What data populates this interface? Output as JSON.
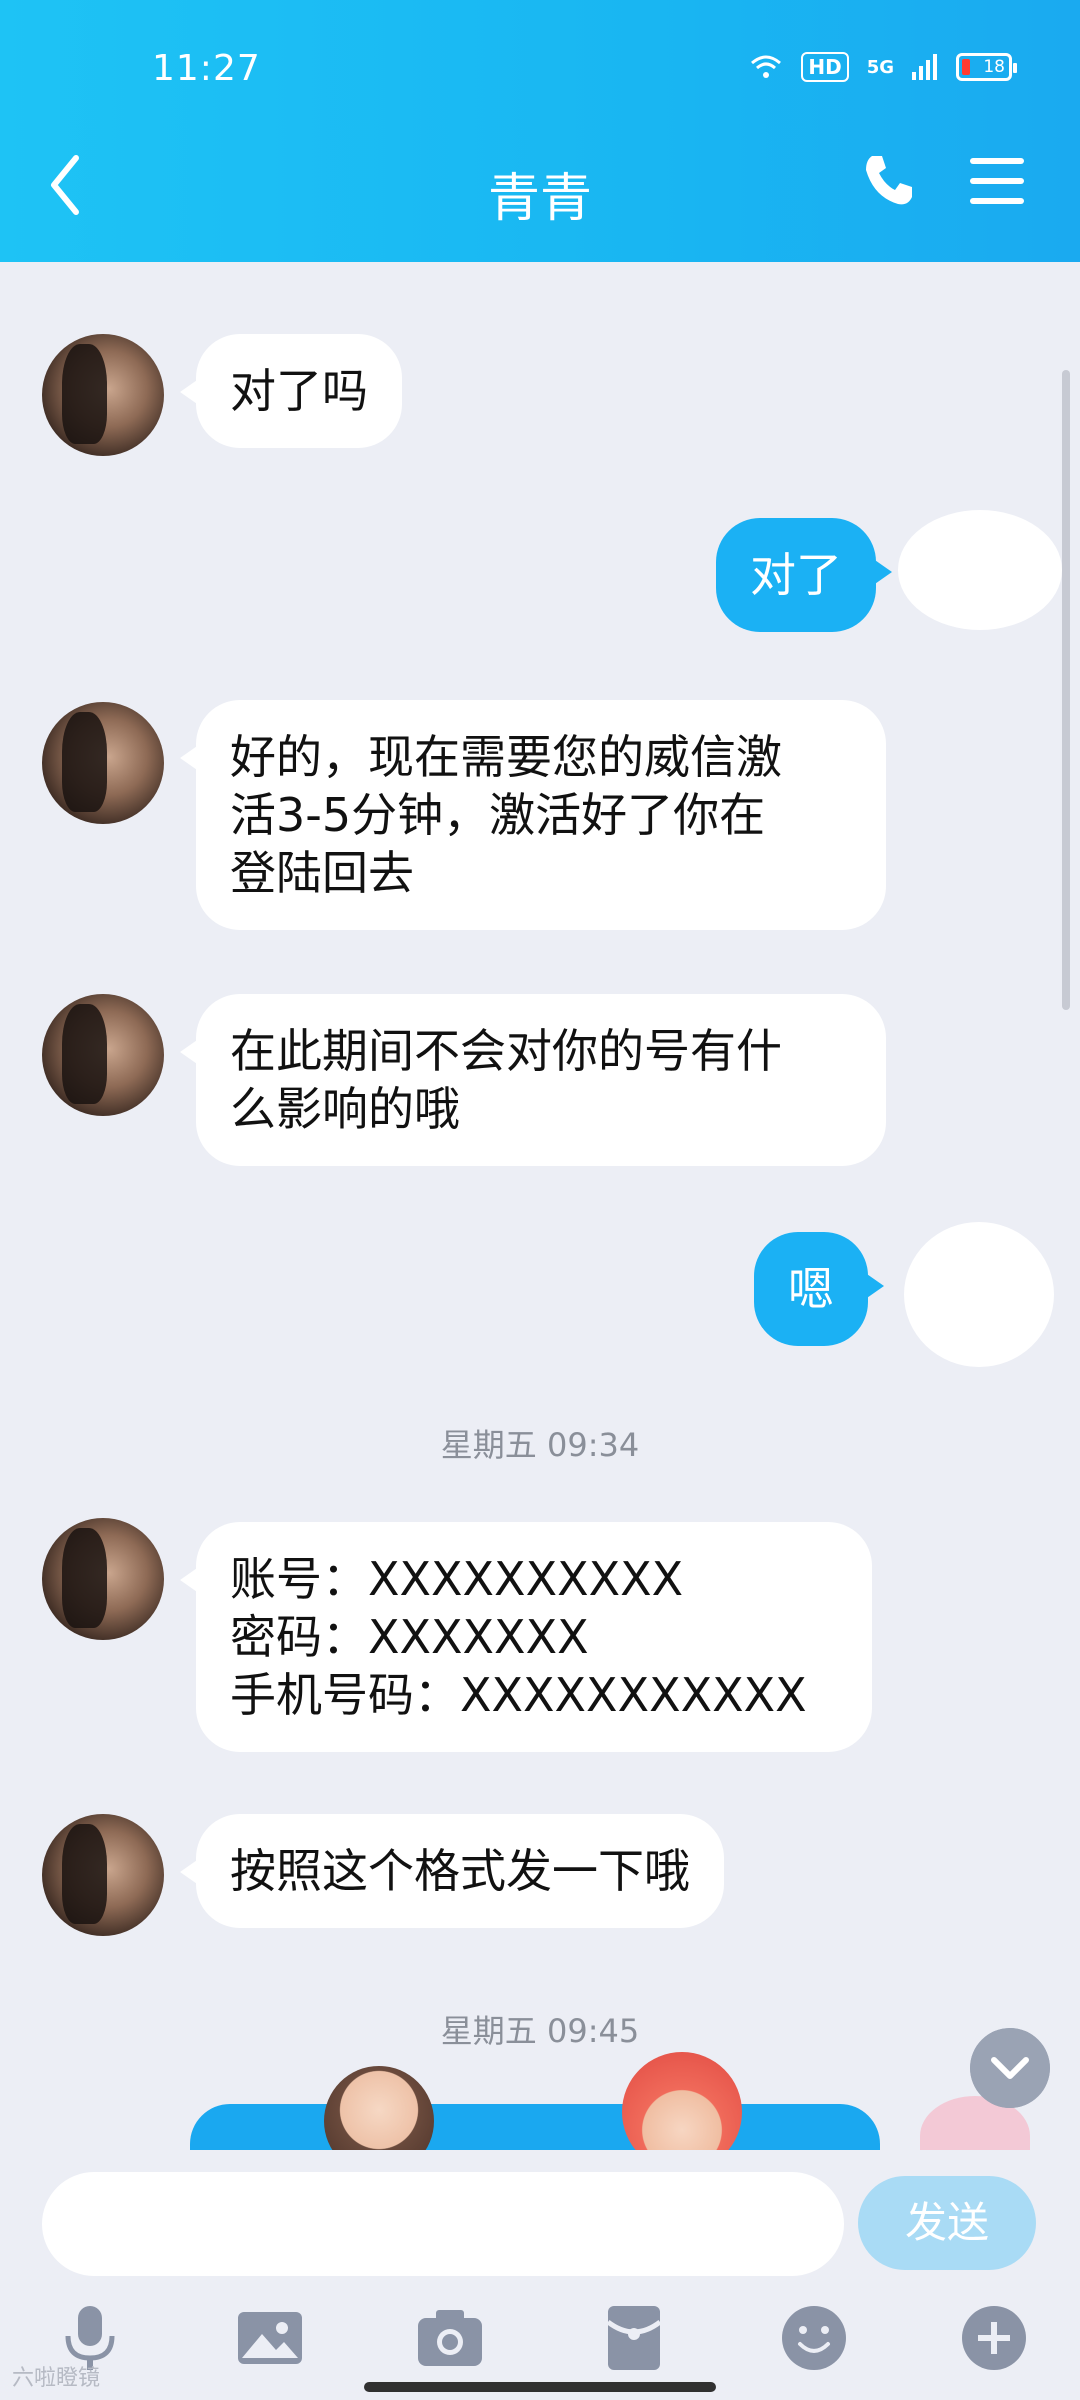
{
  "status_bar": {
    "time": "11:27",
    "hd": "HD",
    "network": "5G",
    "battery": "18"
  },
  "header": {
    "title": "青青",
    "back_icon": "chevron-left-icon",
    "phone_icon": "phone-icon",
    "menu_icon": "menu-icon"
  },
  "timestamps": {
    "t1": "星期五 09:34",
    "t2": "星期五 09:45"
  },
  "messages": [
    {
      "side": "in",
      "text": "对了吗"
    },
    {
      "side": "out",
      "text": "对了"
    },
    {
      "side": "in",
      "lines": [
        "好的，现在需要您的威信激",
        "活3-5分钟，激活好了你在",
        "登陆回去"
      ]
    },
    {
      "side": "in",
      "lines": [
        "在此期间不会对你的号有什",
        "么影响的哦"
      ]
    },
    {
      "side": "out",
      "text": "嗯"
    },
    {
      "side": "in",
      "lines": [
        "账号：XXXXXXXXXX",
        "密码：XXXXXXX",
        "手机号码：XXXXXXXXXXX"
      ]
    },
    {
      "side": "in",
      "text": "按照这个格式发一下哦"
    }
  ],
  "input": {
    "placeholder": "",
    "send_label": "发送"
  },
  "toolbar": [
    "microphone-icon",
    "image-icon",
    "camera-icon",
    "red-packet-icon",
    "emoji-icon",
    "plus-icon"
  ],
  "colors": {
    "header": "#1bb8f3",
    "outgoing": "#1bb1f4",
    "background": "#eceef5",
    "send_disabled": "#a9dbf5"
  },
  "watermark": "六啦瞪镜"
}
